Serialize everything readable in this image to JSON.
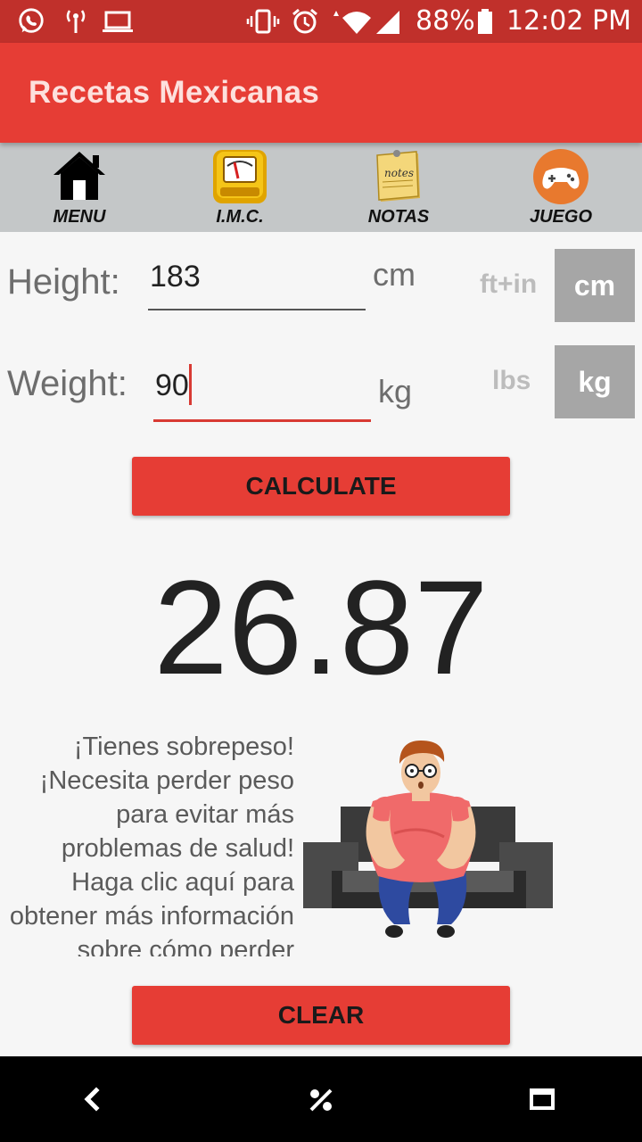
{
  "status_bar": {
    "icons": [
      "whatsapp-icon",
      "hotspot-icon",
      "laptop-icon",
      "vibrate-icon",
      "alarm-icon",
      "wifi-icon",
      "signal-icon",
      "battery-icon"
    ],
    "battery": "88%",
    "time": "12:02 PM"
  },
  "app_bar": {
    "title": "Recetas Mexicanas",
    "color": "#e63d35"
  },
  "nav": [
    {
      "label": "MENU",
      "icon": "home-icon"
    },
    {
      "label": "I.M.C.",
      "icon": "scale-icon"
    },
    {
      "label": "NOTAS",
      "icon": "notes-icon"
    },
    {
      "label": "JUEGO",
      "icon": "gamepad-icon"
    }
  ],
  "form": {
    "height_label": "Height:",
    "height_value": "183",
    "height_unit": "cm",
    "height_alt_unit": "ft+in",
    "height_selected_unit": "cm",
    "weight_label": "Weight:",
    "weight_value": "90",
    "weight_unit": "kg",
    "weight_alt_unit": "lbs",
    "weight_selected_unit": "kg"
  },
  "calculate_label": "CALCULATE",
  "result": "26.87",
  "message": "¡Tienes sobrepeso! ¡Necesita perder peso para evitar más problemas de salud! Haga clic aquí para obtener más información sobre cómo perder",
  "clear_label": "CLEAR",
  "system_nav": [
    "back-icon",
    "home-icon",
    "recents-icon"
  ]
}
